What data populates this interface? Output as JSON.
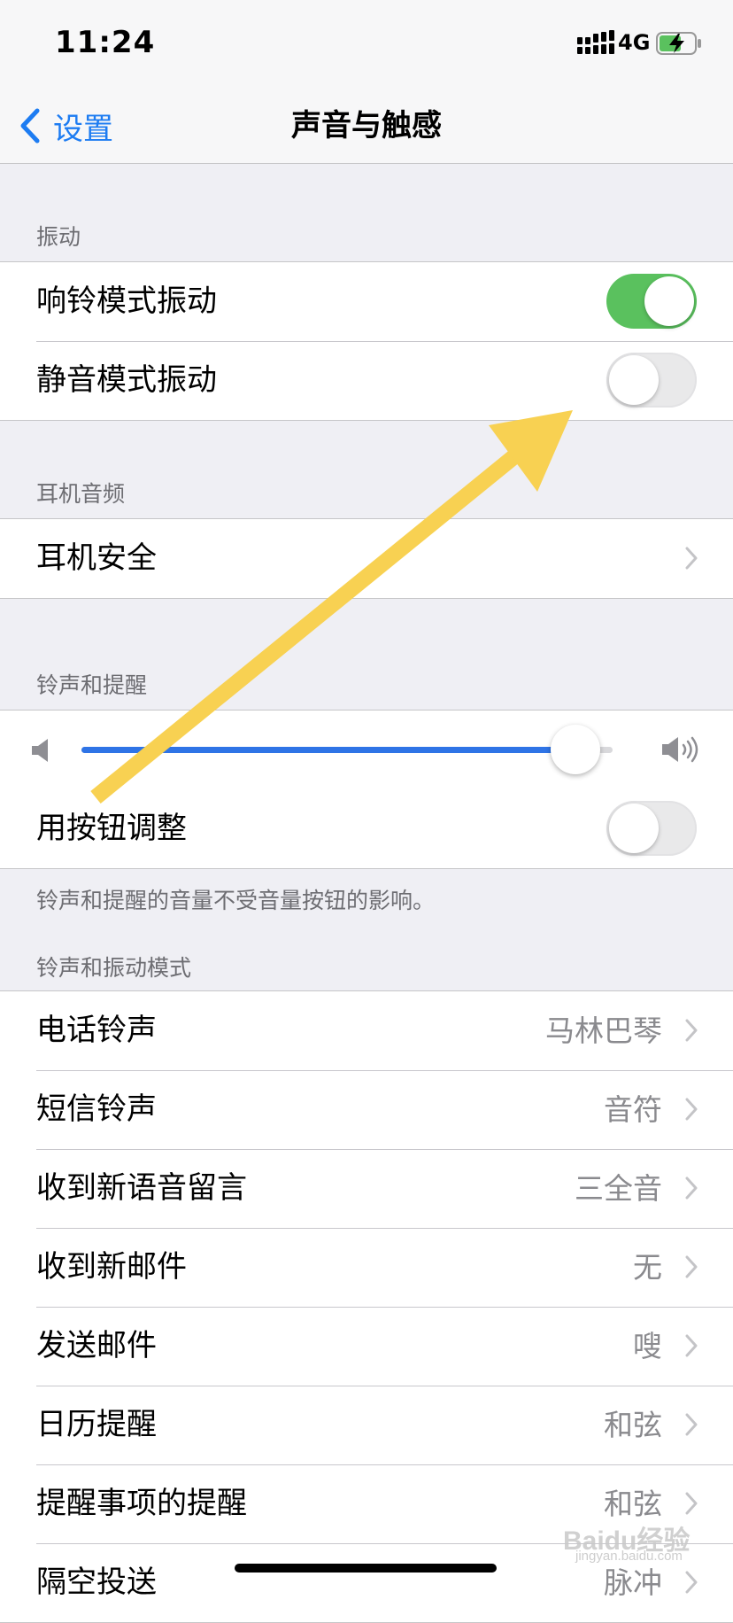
{
  "status_bar": {
    "time": "11:24",
    "network": "4G",
    "battery_charging": true
  },
  "nav": {
    "back_label": "设置",
    "title": "声音与触感"
  },
  "vibration": {
    "header": "振动",
    "rows": [
      {
        "label": "响铃模式振动",
        "on": true
      },
      {
        "label": "静音模式振动",
        "on": false
      }
    ]
  },
  "headphone_audio": {
    "header": "耳机音频",
    "rows": [
      {
        "label": "耳机安全"
      }
    ]
  },
  "ringer_alerts": {
    "header": "铃声和提醒",
    "volume_level": 0.93,
    "change_with_buttons": {
      "label": "用按钮调整",
      "on": false
    },
    "footer": "铃声和提醒的音量不受音量按钮的影响。"
  },
  "sounds_patterns": {
    "header": "铃声和振动模式",
    "rows": [
      {
        "label": "电话铃声",
        "value": "马林巴琴"
      },
      {
        "label": "短信铃声",
        "value": "音符"
      },
      {
        "label": "收到新语音留言",
        "value": "三全音"
      },
      {
        "label": "收到新邮件",
        "value": "无"
      },
      {
        "label": "发送邮件",
        "value": "嗖"
      },
      {
        "label": "日历提醒",
        "value": "和弦"
      },
      {
        "label": "提醒事项的提醒",
        "value": "和弦"
      },
      {
        "label": "隔空投送",
        "value": "脉冲"
      }
    ]
  },
  "watermark": {
    "text": "Baidu经验",
    "sub": "jingyan.baidu.com"
  },
  "colors": {
    "accent": "#1d7cf2",
    "toggle_on": "#5ac15e",
    "slider_fill": "#2f74e6",
    "annotation_arrow": "#f8d152"
  }
}
